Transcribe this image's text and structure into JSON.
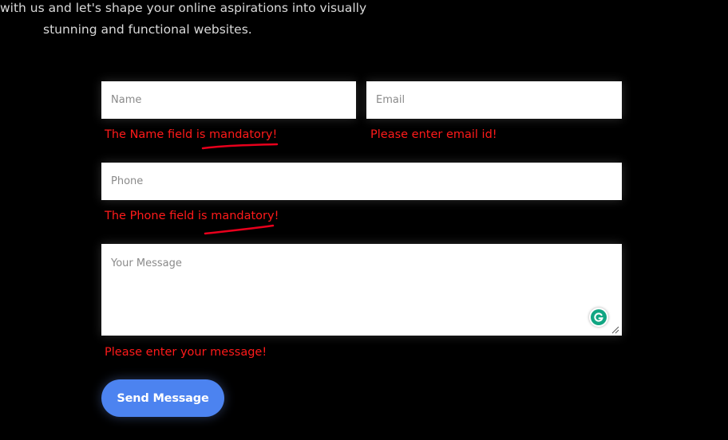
{
  "intro": {
    "line1": "with us and let's shape your online aspirations into visually",
    "line2": "stunning and functional websites."
  },
  "form": {
    "name_placeholder": "Name",
    "email_placeholder": "Email",
    "phone_placeholder": "Phone",
    "message_placeholder": "Your Message",
    "name_error": "The Name field is mandatory!",
    "email_error": "Please enter email id!",
    "phone_error": "The Phone field is mandatory!",
    "message_error": "Please enter your message!",
    "submit_label": "Send Message"
  },
  "colors": {
    "background": "#000000",
    "error": "#ff1a1a",
    "button": "#4c83f0",
    "annotation": "#e8001c"
  },
  "icons": {
    "grammarly": "grammarly-icon",
    "resize": "resize-handle-icon"
  }
}
